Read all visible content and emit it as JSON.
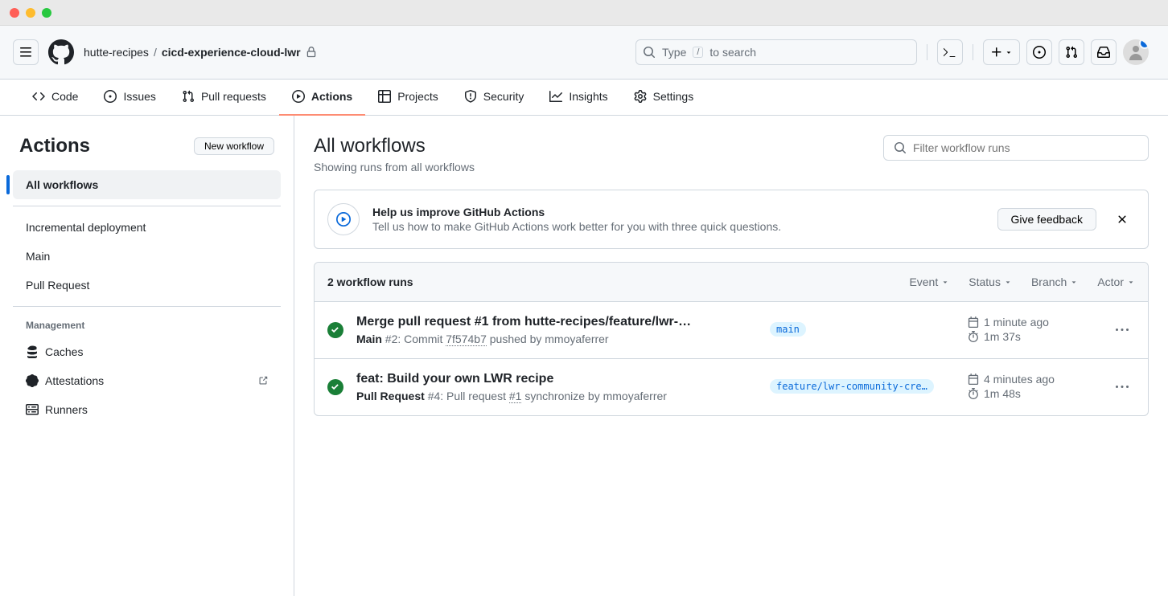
{
  "breadcrumb": {
    "owner": "hutte-recipes",
    "repo": "cicd-experience-cloud-lwr"
  },
  "search": {
    "prefix": "Type",
    "key": "/",
    "suffix": "to search"
  },
  "nav": {
    "code": "Code",
    "issues": "Issues",
    "pull_requests": "Pull requests",
    "actions": "Actions",
    "projects": "Projects",
    "security": "Security",
    "insights": "Insights",
    "settings": "Settings"
  },
  "sidebar": {
    "title": "Actions",
    "new_workflow": "New workflow",
    "all_workflows": "All workflows",
    "workflows": [
      "Incremental deployment",
      "Main",
      "Pull Request"
    ],
    "management_label": "Management",
    "management": {
      "caches": "Caches",
      "attestations": "Attestations",
      "runners": "Runners"
    }
  },
  "content": {
    "title": "All workflows",
    "subtitle": "Showing runs from all workflows",
    "filter_placeholder": "Filter workflow runs"
  },
  "banner": {
    "title": "Help us improve GitHub Actions",
    "desc": "Tell us how to make GitHub Actions work better for you with three quick questions.",
    "button": "Give feedback"
  },
  "runs": {
    "count": "2 workflow runs",
    "filters": {
      "event": "Event",
      "status": "Status",
      "branch": "Branch",
      "actor": "Actor"
    },
    "items": [
      {
        "title": "Merge pull request #1 from hutte-recipes/feature/lwr-…",
        "workflow": "Main",
        "run_num": "#2",
        "meta_prefix": ": Commit ",
        "link": "7f574b7",
        "meta_suffix": " pushed by mmoyaferrer",
        "branch": "main",
        "time_ago": "1 minute ago",
        "duration": "1m 37s"
      },
      {
        "title": "feat: Build your own LWR recipe",
        "workflow": "Pull Request",
        "run_num": "#4",
        "meta_prefix": ": Pull request ",
        "link": "#1",
        "meta_suffix": " synchronize by mmoyaferrer",
        "branch": "feature/lwr-community-cre…",
        "time_ago": "4 minutes ago",
        "duration": "1m 48s"
      }
    ]
  }
}
